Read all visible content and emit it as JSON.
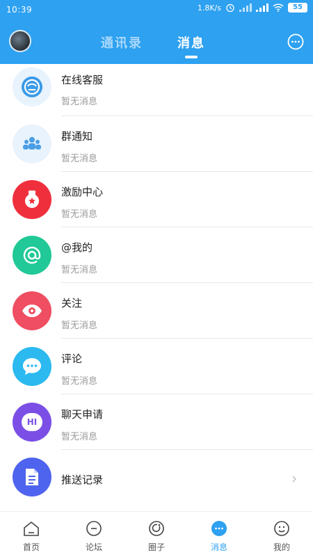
{
  "status": {
    "time": "10:39",
    "speed": "1.8K/s",
    "battery": "55"
  },
  "header": {
    "tab_contacts": "通讯录",
    "tab_messages": "消息"
  },
  "messages": [
    {
      "title": "在线客服",
      "subtitle": "暂无消息",
      "icon": "customer-service-icon",
      "color": "#3b9be8"
    },
    {
      "title": "群通知",
      "subtitle": "暂无消息",
      "icon": "group-icon",
      "color": "#4a9ee6"
    },
    {
      "title": "激励中心",
      "subtitle": "暂无消息",
      "icon": "badge-icon",
      "color": "#ef2f3c"
    },
    {
      "title": "@我的",
      "subtitle": "暂无消息",
      "icon": "at-icon",
      "color": "#20c997"
    },
    {
      "title": "关注",
      "subtitle": "暂无消息",
      "icon": "eye-icon",
      "color": "#f04e62"
    },
    {
      "title": "评论",
      "subtitle": "暂无消息",
      "icon": "comment-icon",
      "color": "#2bb9f0"
    },
    {
      "title": "聊天申请",
      "subtitle": "暂无消息",
      "icon": "hi-icon",
      "color": "#7b4fe6"
    },
    {
      "title": "推送记录",
      "icon": "document-icon",
      "color": "#4e64ee"
    }
  ],
  "icons": {
    "hi_text": "HI"
  },
  "bottom_nav": [
    {
      "label": "首页",
      "icon": "home-icon"
    },
    {
      "label": "论坛",
      "icon": "forum-icon"
    },
    {
      "label": "圈子",
      "icon": "circle-icon"
    },
    {
      "label": "消息",
      "icon": "message-icon",
      "active": true
    },
    {
      "label": "我的",
      "icon": "profile-icon"
    }
  ],
  "colors": {
    "primary": "#2ea1f0",
    "divider": "#e7e7e7",
    "subtext": "#9a9a9a"
  }
}
